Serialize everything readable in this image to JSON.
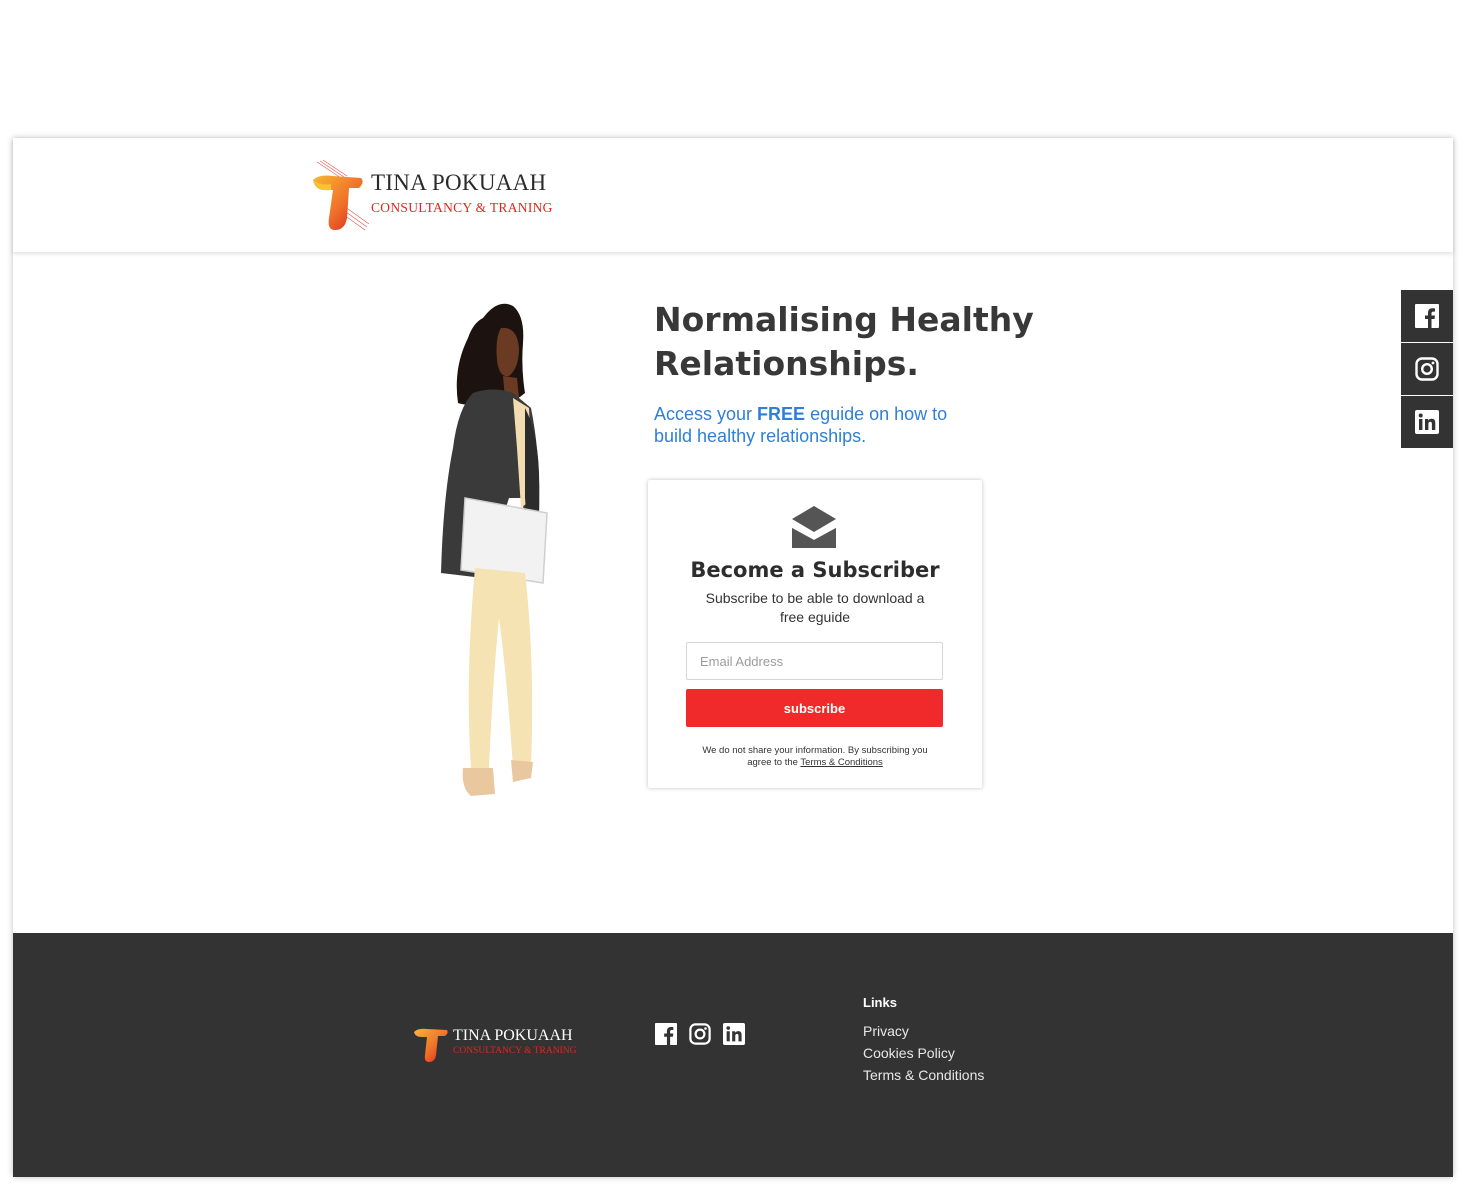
{
  "brand": {
    "name": "TINA POKUAAH",
    "tagline": "CONSULTANCY & TRANING",
    "colors": {
      "red": "#e2261c",
      "orange": "#f29a1a",
      "dark": "#333333"
    }
  },
  "hero": {
    "headline": "Normalising Healthy Relationships.",
    "sub_prefix": "Access your ",
    "sub_bold": "FREE",
    "sub_suffix": " eguide on how to build healthy relationships.",
    "link_color": "#2f7fd8"
  },
  "subscribe_card": {
    "icon": "envelope-open-icon",
    "title": "Become a Subscriber",
    "description": "Subscribe to be able to download a free eguide",
    "email_placeholder": "Email Address",
    "button_label": "subscribe",
    "button_color": "#f02a2a",
    "disclaimer_text": "We do not share your information. By subscribing you agree to the ",
    "terms_link": "Terms & Conditions"
  },
  "social_sidebar": [
    "facebook-icon",
    "instagram-icon",
    "linkedin-icon"
  ],
  "footer": {
    "links_heading": "Links",
    "links": [
      "Privacy",
      "Cookies Policy",
      "Terms & Conditions"
    ]
  }
}
